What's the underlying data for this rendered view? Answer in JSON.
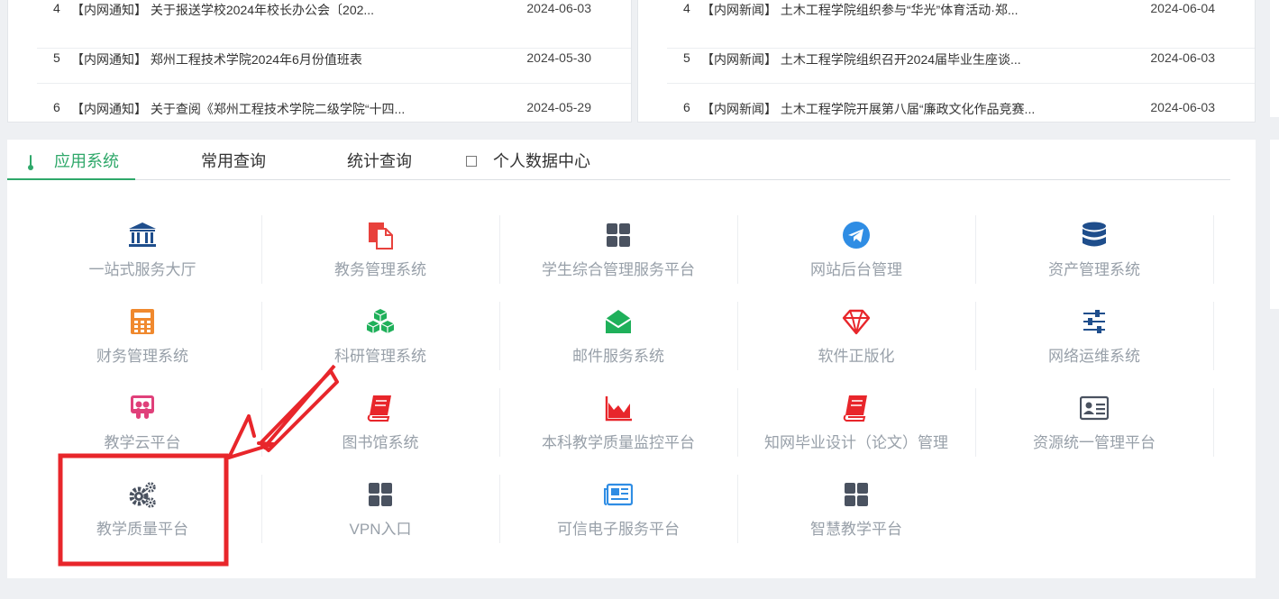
{
  "left_news": {
    "rows": [
      {
        "num": "4",
        "title": "【内网通知】 关于报送学校2024年校长办公会〔202...",
        "date": "2024-06-03"
      },
      {
        "num": "5",
        "title": "【内网通知】 郑州工程技术学院2024年6月份值班表",
        "date": "2024-05-30"
      },
      {
        "num": "6",
        "title": "【内网通知】 关于查阅《郑州工程技术学院二级学院“十四...",
        "date": "2024-05-29"
      }
    ]
  },
  "right_news": {
    "rows": [
      {
        "num": "4",
        "title": "【内网新闻】 土木工程学院组织参与“华光”体育活动·郑...",
        "date": "2024-06-04"
      },
      {
        "num": "5",
        "title": "【内网新闻】 土木工程学院组织召开2024届毕业生座谈...",
        "date": "2024-06-03"
      },
      {
        "num": "6",
        "title": "【内网新闻】 土木工程学院开展第八届“廉政文化作品竞赛...",
        "date": "2024-06-03"
      }
    ]
  },
  "tabs": [
    "应用系统",
    "常用查询",
    "统计查询",
    "个人数据中心"
  ],
  "apps": [
    {
      "label": "一站式服务大厅",
      "icon": "bank-icon"
    },
    {
      "label": "教务管理系统",
      "icon": "document-icon"
    },
    {
      "label": "学生综合管理服务平台",
      "icon": "grid-icon"
    },
    {
      "label": "网站后台管理",
      "icon": "telegram-icon"
    },
    {
      "label": "资产管理系统",
      "icon": "database-icon"
    },
    {
      "label": "财务管理系统",
      "icon": "calculator-icon"
    },
    {
      "label": "科研管理系统",
      "icon": "cubes-icon"
    },
    {
      "label": "邮件服务系统",
      "icon": "envelope-open-icon"
    },
    {
      "label": "软件正版化",
      "icon": "diamond-icon"
    },
    {
      "label": "网络运维系统",
      "icon": "sliders-icon"
    },
    {
      "label": "教学云平台",
      "icon": "slideshare-icon"
    },
    {
      "label": "图书馆系统",
      "icon": "book-icon"
    },
    {
      "label": "本科教学质量监控平台",
      "icon": "area-chart-icon"
    },
    {
      "label": "知网毕业设计（论文）管理",
      "icon": "book-icon"
    },
    {
      "label": "资源统一管理平台",
      "icon": "id-card-icon"
    },
    {
      "label": "教学质量平台",
      "icon": "gears-icon"
    },
    {
      "label": "VPN入口",
      "icon": "grid-icon"
    },
    {
      "label": "可信电子服务平台",
      "icon": "newspaper-icon"
    },
    {
      "label": "智慧教学平台",
      "icon": "grid-icon"
    }
  ],
  "colors": {
    "accent": "#2fa86a",
    "annotation_red": "#e8262b",
    "icon_navy": "#1f4e8c",
    "icon_red": "#e8413c",
    "icon_green": "#1fb05a",
    "icon_orange": "#f0892e",
    "icon_gray": "#4a5260",
    "icon_blue": "#2f8de4"
  }
}
